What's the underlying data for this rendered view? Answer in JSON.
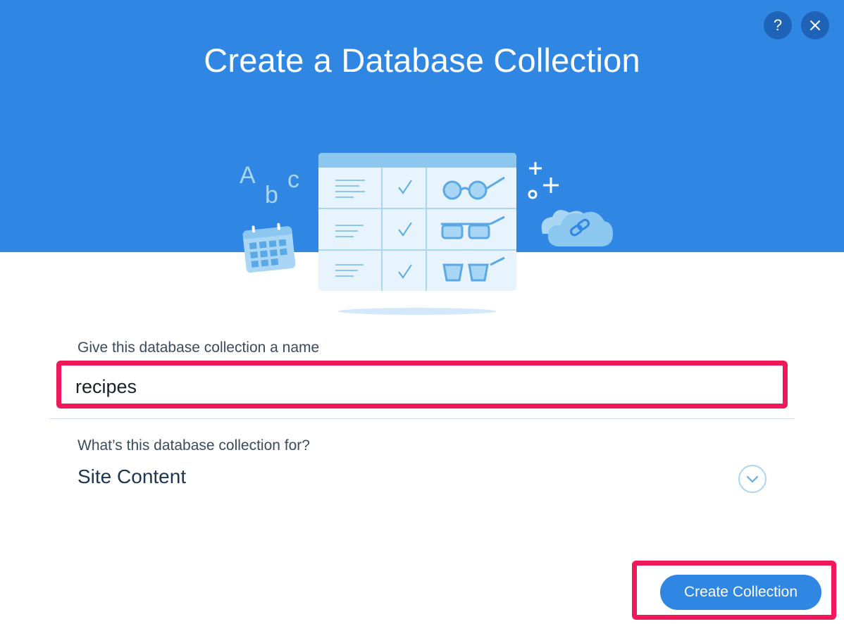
{
  "dialog": {
    "title": "Create a Database Collection",
    "help_glyph": "?",
    "close_glyph": "×"
  },
  "illustration": {
    "letters": [
      "A",
      "b",
      "c"
    ]
  },
  "form": {
    "name_label": "Give this database collection a name",
    "name_value": "recipes",
    "purpose_label": "What’s this database collection for?",
    "purpose_value": "Site Content"
  },
  "footer": {
    "create_label": "Create Collection"
  },
  "colors": {
    "header_blue": "#2f86e3",
    "highlight_pink": "#f0185a",
    "button_blue": "#2f86e3"
  }
}
